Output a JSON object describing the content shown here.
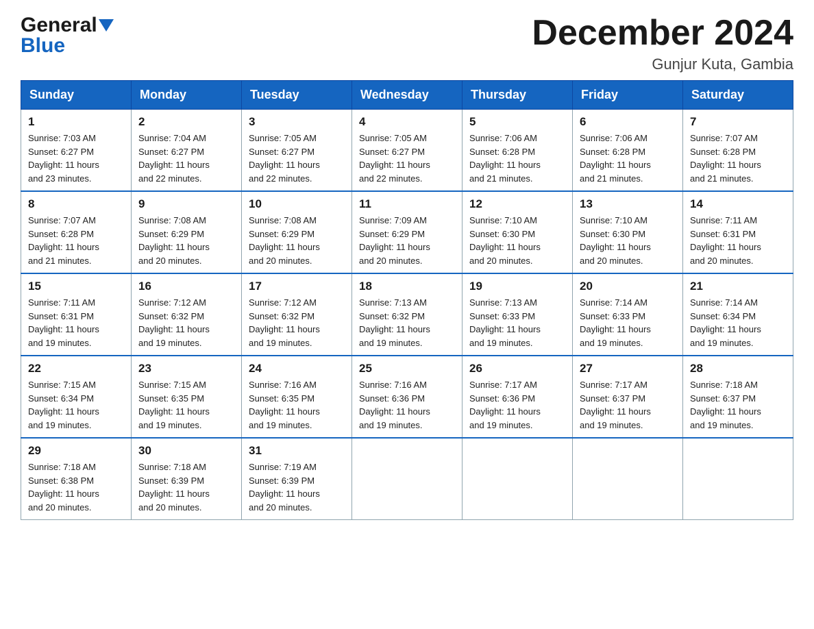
{
  "header": {
    "logo_general": "General",
    "logo_blue": "Blue",
    "month_title": "December 2024",
    "location": "Gunjur Kuta, Gambia"
  },
  "days_of_week": [
    "Sunday",
    "Monday",
    "Tuesday",
    "Wednesday",
    "Thursday",
    "Friday",
    "Saturday"
  ],
  "weeks": [
    [
      {
        "day": "1",
        "sunrise": "7:03 AM",
        "sunset": "6:27 PM",
        "daylight": "11 hours and 23 minutes."
      },
      {
        "day": "2",
        "sunrise": "7:04 AM",
        "sunset": "6:27 PM",
        "daylight": "11 hours and 22 minutes."
      },
      {
        "day": "3",
        "sunrise": "7:05 AM",
        "sunset": "6:27 PM",
        "daylight": "11 hours and 22 minutes."
      },
      {
        "day": "4",
        "sunrise": "7:05 AM",
        "sunset": "6:27 PM",
        "daylight": "11 hours and 22 minutes."
      },
      {
        "day": "5",
        "sunrise": "7:06 AM",
        "sunset": "6:28 PM",
        "daylight": "11 hours and 21 minutes."
      },
      {
        "day": "6",
        "sunrise": "7:06 AM",
        "sunset": "6:28 PM",
        "daylight": "11 hours and 21 minutes."
      },
      {
        "day": "7",
        "sunrise": "7:07 AM",
        "sunset": "6:28 PM",
        "daylight": "11 hours and 21 minutes."
      }
    ],
    [
      {
        "day": "8",
        "sunrise": "7:07 AM",
        "sunset": "6:28 PM",
        "daylight": "11 hours and 21 minutes."
      },
      {
        "day": "9",
        "sunrise": "7:08 AM",
        "sunset": "6:29 PM",
        "daylight": "11 hours and 20 minutes."
      },
      {
        "day": "10",
        "sunrise": "7:08 AM",
        "sunset": "6:29 PM",
        "daylight": "11 hours and 20 minutes."
      },
      {
        "day": "11",
        "sunrise": "7:09 AM",
        "sunset": "6:29 PM",
        "daylight": "11 hours and 20 minutes."
      },
      {
        "day": "12",
        "sunrise": "7:10 AM",
        "sunset": "6:30 PM",
        "daylight": "11 hours and 20 minutes."
      },
      {
        "day": "13",
        "sunrise": "7:10 AM",
        "sunset": "6:30 PM",
        "daylight": "11 hours and 20 minutes."
      },
      {
        "day": "14",
        "sunrise": "7:11 AM",
        "sunset": "6:31 PM",
        "daylight": "11 hours and 20 minutes."
      }
    ],
    [
      {
        "day": "15",
        "sunrise": "7:11 AM",
        "sunset": "6:31 PM",
        "daylight": "11 hours and 19 minutes."
      },
      {
        "day": "16",
        "sunrise": "7:12 AM",
        "sunset": "6:32 PM",
        "daylight": "11 hours and 19 minutes."
      },
      {
        "day": "17",
        "sunrise": "7:12 AM",
        "sunset": "6:32 PM",
        "daylight": "11 hours and 19 minutes."
      },
      {
        "day": "18",
        "sunrise": "7:13 AM",
        "sunset": "6:32 PM",
        "daylight": "11 hours and 19 minutes."
      },
      {
        "day": "19",
        "sunrise": "7:13 AM",
        "sunset": "6:33 PM",
        "daylight": "11 hours and 19 minutes."
      },
      {
        "day": "20",
        "sunrise": "7:14 AM",
        "sunset": "6:33 PM",
        "daylight": "11 hours and 19 minutes."
      },
      {
        "day": "21",
        "sunrise": "7:14 AM",
        "sunset": "6:34 PM",
        "daylight": "11 hours and 19 minutes."
      }
    ],
    [
      {
        "day": "22",
        "sunrise": "7:15 AM",
        "sunset": "6:34 PM",
        "daylight": "11 hours and 19 minutes."
      },
      {
        "day": "23",
        "sunrise": "7:15 AM",
        "sunset": "6:35 PM",
        "daylight": "11 hours and 19 minutes."
      },
      {
        "day": "24",
        "sunrise": "7:16 AM",
        "sunset": "6:35 PM",
        "daylight": "11 hours and 19 minutes."
      },
      {
        "day": "25",
        "sunrise": "7:16 AM",
        "sunset": "6:36 PM",
        "daylight": "11 hours and 19 minutes."
      },
      {
        "day": "26",
        "sunrise": "7:17 AM",
        "sunset": "6:36 PM",
        "daylight": "11 hours and 19 minutes."
      },
      {
        "day": "27",
        "sunrise": "7:17 AM",
        "sunset": "6:37 PM",
        "daylight": "11 hours and 19 minutes."
      },
      {
        "day": "28",
        "sunrise": "7:18 AM",
        "sunset": "6:37 PM",
        "daylight": "11 hours and 19 minutes."
      }
    ],
    [
      {
        "day": "29",
        "sunrise": "7:18 AM",
        "sunset": "6:38 PM",
        "daylight": "11 hours and 20 minutes."
      },
      {
        "day": "30",
        "sunrise": "7:18 AM",
        "sunset": "6:39 PM",
        "daylight": "11 hours and 20 minutes."
      },
      {
        "day": "31",
        "sunrise": "7:19 AM",
        "sunset": "6:39 PM",
        "daylight": "11 hours and 20 minutes."
      },
      null,
      null,
      null,
      null
    ]
  ],
  "labels": {
    "sunrise": "Sunrise:",
    "sunset": "Sunset:",
    "daylight": "Daylight:"
  }
}
